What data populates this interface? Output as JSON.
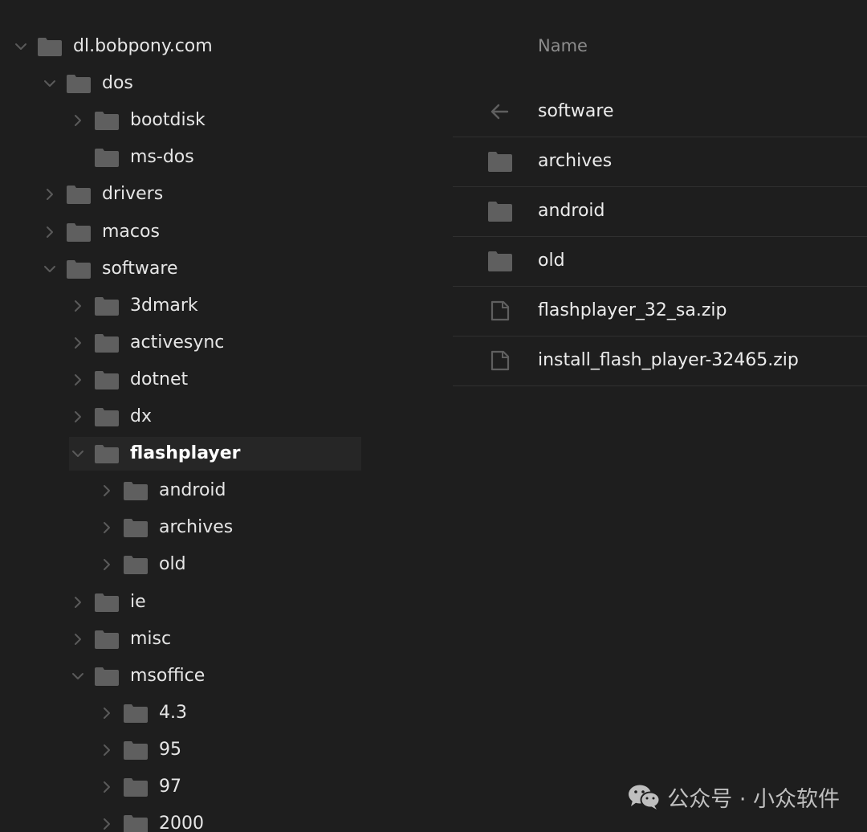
{
  "colors": {
    "background": "#1e1e1e",
    "folder": "#5f5f5f",
    "chevron": "#5a5a5a",
    "text": "#e6e6e6",
    "muted": "#8c8c8c",
    "selected_row": "#262626"
  },
  "tree": {
    "items": [
      {
        "label": "dl.bobpony.com",
        "depth": 0,
        "expanded": true,
        "chevron": "chevron-down-icon"
      },
      {
        "label": "dos",
        "depth": 1,
        "expanded": true,
        "chevron": "chevron-down-icon"
      },
      {
        "label": "bootdisk",
        "depth": 2,
        "expanded": false,
        "chevron": "chevron-right-icon"
      },
      {
        "label": "ms-dos",
        "depth": 2,
        "chevron": null
      },
      {
        "label": "drivers",
        "depth": 1,
        "expanded": false,
        "chevron": "chevron-right-icon"
      },
      {
        "label": "macos",
        "depth": 1,
        "expanded": false,
        "chevron": "chevron-right-icon"
      },
      {
        "label": "software",
        "depth": 1,
        "expanded": true,
        "chevron": "chevron-down-icon"
      },
      {
        "label": "3dmark",
        "depth": 2,
        "expanded": false,
        "chevron": "chevron-right-icon"
      },
      {
        "label": "activesync",
        "depth": 2,
        "expanded": false,
        "chevron": "chevron-right-icon"
      },
      {
        "label": "dotnet",
        "depth": 2,
        "expanded": false,
        "chevron": "chevron-right-icon"
      },
      {
        "label": "dx",
        "depth": 2,
        "expanded": false,
        "chevron": "chevron-right-icon"
      },
      {
        "label": "flashplayer",
        "depth": 2,
        "expanded": true,
        "chevron": "chevron-down-icon",
        "selected": true
      },
      {
        "label": "android",
        "depth": 3,
        "expanded": false,
        "chevron": "chevron-right-icon"
      },
      {
        "label": "archives",
        "depth": 3,
        "expanded": false,
        "chevron": "chevron-right-icon"
      },
      {
        "label": "old",
        "depth": 3,
        "expanded": false,
        "chevron": "chevron-right-icon"
      },
      {
        "label": "ie",
        "depth": 2,
        "expanded": false,
        "chevron": "chevron-right-icon"
      },
      {
        "label": "misc",
        "depth": 2,
        "expanded": false,
        "chevron": "chevron-right-icon"
      },
      {
        "label": "msoffice",
        "depth": 2,
        "expanded": true,
        "chevron": "chevron-down-icon"
      },
      {
        "label": "4.3",
        "depth": 3,
        "expanded": false,
        "chevron": "chevron-right-icon"
      },
      {
        "label": "95",
        "depth": 3,
        "expanded": false,
        "chevron": "chevron-right-icon"
      },
      {
        "label": "97",
        "depth": 3,
        "expanded": false,
        "chevron": "chevron-right-icon"
      },
      {
        "label": "2000",
        "depth": 3,
        "expanded": false,
        "chevron": "chevron-right-icon"
      }
    ]
  },
  "list": {
    "column_header": "Name",
    "rows": [
      {
        "label": "software",
        "icon": "arrow-left-icon",
        "kind": "parent"
      },
      {
        "label": "archives",
        "icon": "folder-icon",
        "kind": "folder"
      },
      {
        "label": "android",
        "icon": "folder-icon",
        "kind": "folder"
      },
      {
        "label": "old",
        "icon": "folder-icon",
        "kind": "folder"
      },
      {
        "label": "flashplayer_32_sa.zip",
        "icon": "file-icon",
        "kind": "file"
      },
      {
        "label": "install_flash_player-32465.zip",
        "icon": "file-icon",
        "kind": "file"
      }
    ]
  },
  "watermark": {
    "text": "公众号 · 小众软件",
    "icon": "wechat-logo-icon"
  }
}
